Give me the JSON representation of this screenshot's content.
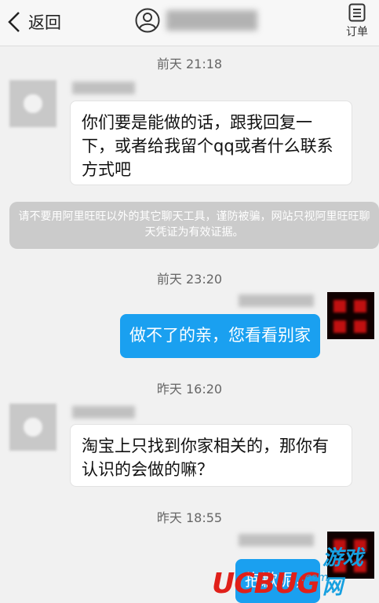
{
  "header": {
    "back_label": "返回",
    "orders_label": "订单"
  },
  "messages": {
    "time1": "前天 21:18",
    "msg1": "你们要是能做的话，跟我回复一下，或者给我留个qq或者什么联系方式吧",
    "system": "请不要用阿里旺旺以外的其它聊天工具，谨防被骗，网站只视阿里旺旺聊天凭证为有效证据。",
    "time2": "前天 23:20",
    "msg2": "做不了的亲，您看看别家",
    "time3": "昨天 16:20",
    "msg3": "淘宝上只找到你家相关的，那你有认识的会做的嘛？",
    "time4": "昨天 18:55",
    "msg4": "抱歉呢，"
  },
  "watermark": {
    "logo": "UCBUG",
    "sub": "游戏网",
    "url": ".com"
  },
  "icons": {
    "back": "chevron-left-icon",
    "contact": "person-icon",
    "orders": "order-list-icon"
  },
  "colors": {
    "outgoing_bubble": "#1aa0f0",
    "incoming_bubble": "#ffffff",
    "system_notice": "#cbcbcb"
  }
}
